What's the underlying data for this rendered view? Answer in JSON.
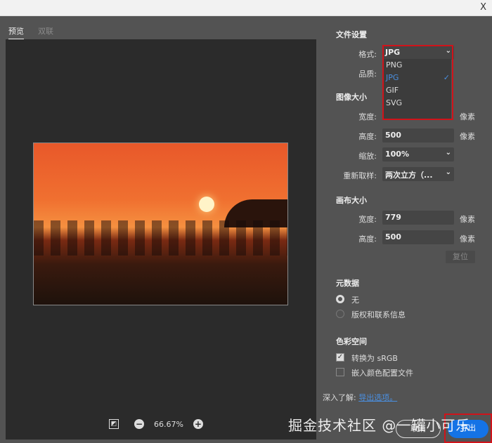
{
  "titlebar": {
    "close": "X"
  },
  "tabs": [
    "预览",
    "双联"
  ],
  "zoom": {
    "level": "66.67%",
    "minus": "−",
    "plus": "+"
  },
  "file_settings": {
    "title": "文件设置",
    "format_label": "格式:",
    "format_value": "JPG",
    "quality_label": "品质:",
    "format_options": [
      "PNG",
      "JPG",
      "GIF",
      "SVG"
    ],
    "selected": "JPG",
    "check": "✓"
  },
  "image_size": {
    "title": "图像大小",
    "width_label": "宽度:",
    "height_label": "高度:",
    "height_value": "500",
    "unit": "像素",
    "scale_label": "缩放:",
    "scale_value": "100%",
    "resample_label": "重新取样:",
    "resample_value": "两次立方（..."
  },
  "canvas_size": {
    "title": "画布大小",
    "width_label": "宽度:",
    "width_value": "779",
    "height_label": "高度:",
    "height_value": "500",
    "unit": "像素",
    "reset": "复位"
  },
  "metadata": {
    "title": "元数据",
    "none": "无",
    "copyright": "版权和联系信息"
  },
  "color_space": {
    "title": "色彩空间",
    "srgb": "转换为 sRGB",
    "embed": "嵌入颜色配置文件",
    "check": "✓"
  },
  "learn_more": {
    "prefix": "深入了解:",
    "link": "导出选项。"
  },
  "buttons": {
    "cancel": "取消",
    "export": "导出"
  },
  "watermark": "掘金技术社区 @一罐小可乐",
  "colors": {
    "accent": "#1473e6",
    "highlight": "#d0131a"
  }
}
